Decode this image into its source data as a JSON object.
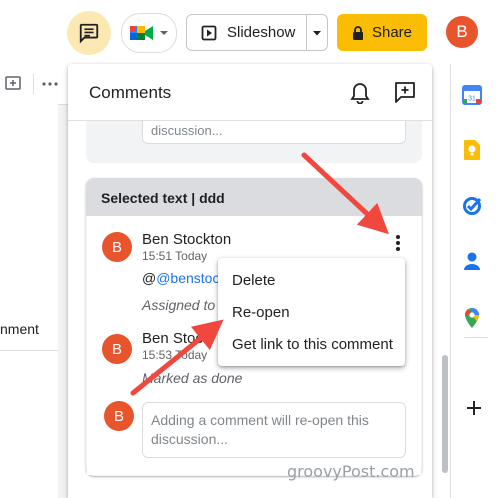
{
  "topbar": {
    "slideshow_label": "Slideshow",
    "share_label": "Share",
    "avatar_initial": "B"
  },
  "left_pane": {
    "partial_text": "nment"
  },
  "comments_panel": {
    "title": "Comments",
    "previous_reply_placeholder": "discussion...",
    "thread": {
      "header": "Selected text | ddd",
      "comments": [
        {
          "author": "Ben Stockton",
          "avatar_initial": "B",
          "time": "15:51 Today",
          "mention": "@benstockt",
          "assigned_text": "Assigned to"
        },
        {
          "author": "Ben Stoc",
          "avatar_initial": "B",
          "time": "15:53 Today",
          "status_text": "Marked as done"
        }
      ],
      "reply_avatar_initial": "B",
      "reply_placeholder": "Adding a comment will re-open this discussion..."
    },
    "context_menu": {
      "items": [
        "Delete",
        "Re-open",
        "Get link to this comment"
      ]
    }
  },
  "watermark": "groovyPost.com",
  "colors": {
    "accent_yellow": "#fbbc04",
    "avatar_orange": "#e8542b",
    "arrow_red": "#f0483e",
    "mention_blue": "#1a73e8"
  }
}
